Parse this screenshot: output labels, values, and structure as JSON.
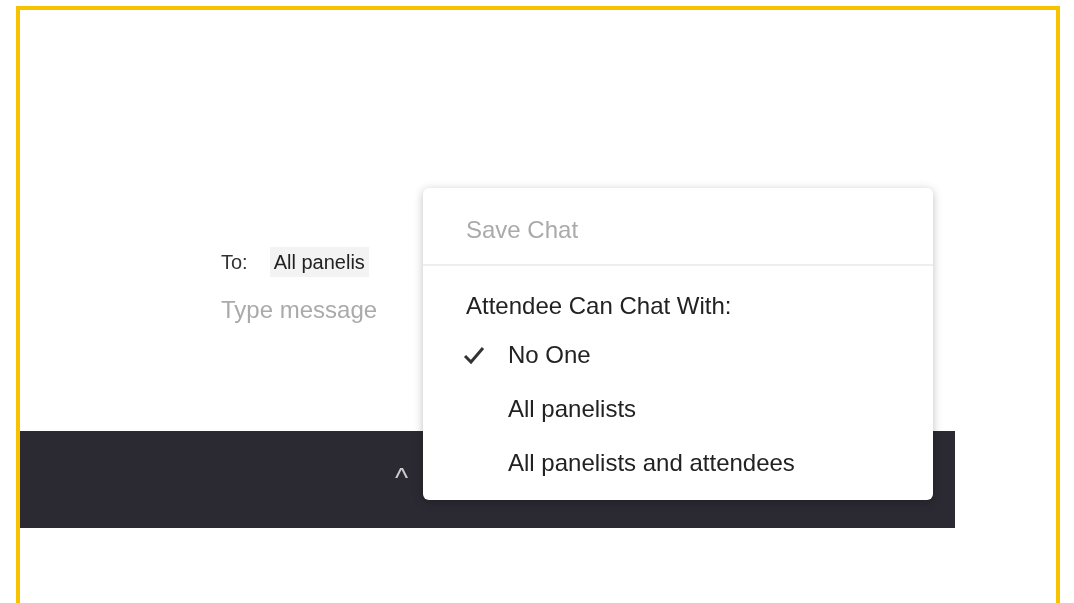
{
  "chat": {
    "to_label": "To:",
    "recipient": "All panelis",
    "message_placeholder": "Type message"
  },
  "menu": {
    "save_item": {
      "label": "Save Chat",
      "disabled": true
    },
    "section_title": "Attendee Can Chat With:",
    "options": [
      {
        "label": "No One",
        "selected": true
      },
      {
        "label": "All panelists",
        "selected": false
      },
      {
        "label": "All panelists and attendees",
        "selected": false
      }
    ]
  },
  "toolbar": {
    "chevron": "^"
  }
}
